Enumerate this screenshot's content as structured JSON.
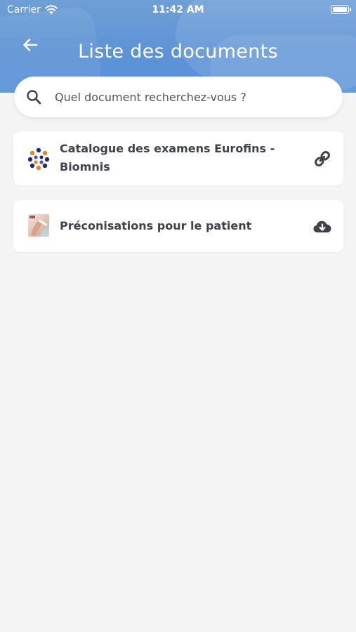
{
  "status_bar": {
    "carrier": "Carrier",
    "time": "11:42 AM"
  },
  "header": {
    "title": "Liste des documents",
    "back_icon": "arrow-left-icon"
  },
  "search": {
    "placeholder": "Quel document recherchez-vous ?",
    "icon": "search-icon"
  },
  "documents": [
    {
      "title": "Catalogue des examens Eurofins - Biomnis",
      "action_icon": "link-icon"
    },
    {
      "title": "Préconisations pour le patient",
      "action_icon": "cloud-download-icon"
    }
  ],
  "colors": {
    "header": "#5d93d6",
    "background": "#f4f4f5",
    "card": "#ffffff",
    "text": "#3e434b",
    "icon": "#3e434b"
  }
}
